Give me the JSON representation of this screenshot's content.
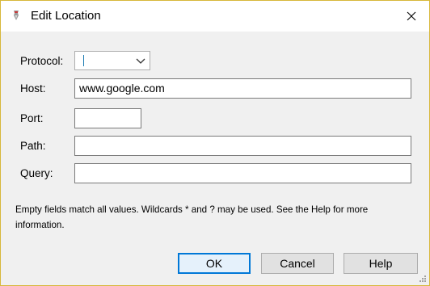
{
  "window": {
    "title": "Edit Location"
  },
  "icons": {
    "app": "app-icon",
    "close": "close-icon",
    "dropdown": "chevron-down-icon"
  },
  "form": {
    "protocol": {
      "label": "Protocol:",
      "value": ""
    },
    "host": {
      "label": "Host:",
      "value": "www.google.com"
    },
    "port": {
      "label": "Port:",
      "value": ""
    },
    "path": {
      "label": "Path:",
      "value": ""
    },
    "query": {
      "label": "Query:",
      "value": ""
    }
  },
  "hint": "Empty fields match all values. Wildcards * and ? may be used. See the Help for more information.",
  "buttons": {
    "ok": "OK",
    "cancel": "Cancel",
    "help": "Help"
  },
  "colors": {
    "accent": "#0078d7",
    "window_border": "#d7b73a",
    "background": "#f0f0f0"
  }
}
